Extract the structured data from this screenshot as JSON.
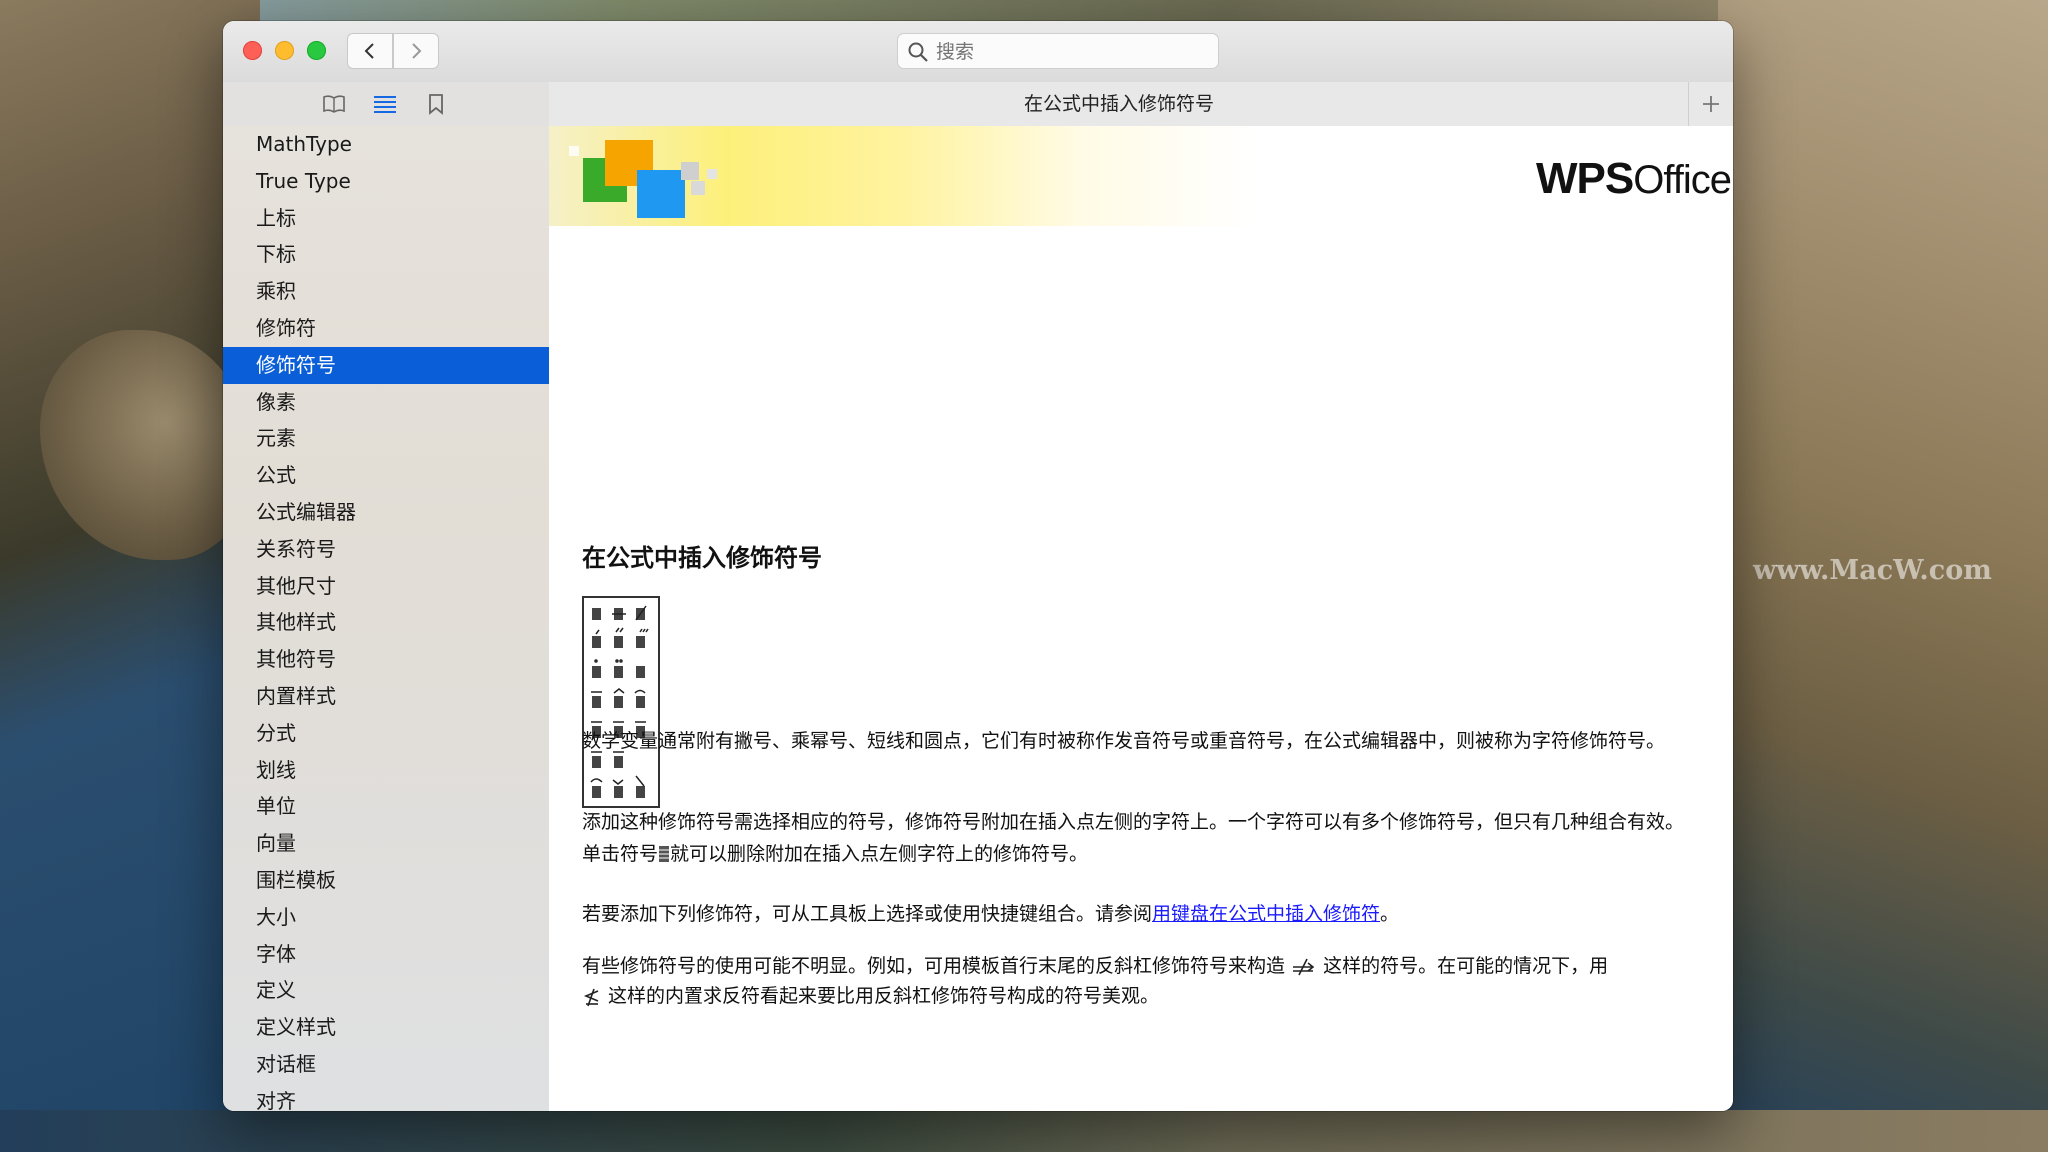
{
  "window": {
    "search_placeholder": "搜索",
    "tab_title": "在公式中插入修饰符号"
  },
  "sidebar": {
    "items": [
      {
        "label": "MathType"
      },
      {
        "label": "True Type"
      },
      {
        "label": "上标"
      },
      {
        "label": "下标"
      },
      {
        "label": "乘积"
      },
      {
        "label": "修饰符"
      },
      {
        "label": "修饰符号",
        "selected": true
      },
      {
        "label": "像素"
      },
      {
        "label": "元素"
      },
      {
        "label": "公式"
      },
      {
        "label": "公式编辑器"
      },
      {
        "label": "关系符号"
      },
      {
        "label": "其他尺寸"
      },
      {
        "label": "其他样式"
      },
      {
        "label": "其他符号"
      },
      {
        "label": "内置样式"
      },
      {
        "label": "分式"
      },
      {
        "label": "划线"
      },
      {
        "label": "单位"
      },
      {
        "label": "向量"
      },
      {
        "label": "围栏模板"
      },
      {
        "label": "大小"
      },
      {
        "label": "字体"
      },
      {
        "label": "定义"
      },
      {
        "label": "定义样式"
      },
      {
        "label": "对话框"
      },
      {
        "label": "对齐"
      }
    ]
  },
  "content": {
    "logo_wps": "WPS",
    "logo_office": "Office",
    "heading": "在公式中插入修饰符号",
    "p1": "数学变量通常附有撇号、乘幂号、短线和圆点，它们有时被称作发音符号或重音符号，在公式编辑器中，则被称为字符修饰符号。",
    "p2a": "添加这种修饰符号需选择相应的符号，修饰符号附加在插入点左侧的字符上。一个字符可以有多个修饰符号，但只有几种组合有效。单击符号",
    "p2b": "就可以删除附加在插入点左侧字符上的修饰符号。",
    "p3a": "若要添加下列修饰符，可从工具板上选择或使用快捷键组合。请参阅",
    "p3_link": "用键盘在公式中插入修饰符",
    "p3b": "。",
    "p4a": "有些修饰符号的使用可能不明显。例如，可用模板首行末尾的反斜杠修饰符号来构造",
    "p4b": "这样的符号。在可能的情况下，用",
    "p4c": "这样的内置求反符看起来要比用反斜杠修饰符号构成的符号美观。"
  },
  "watermark": "www.MacW.com"
}
